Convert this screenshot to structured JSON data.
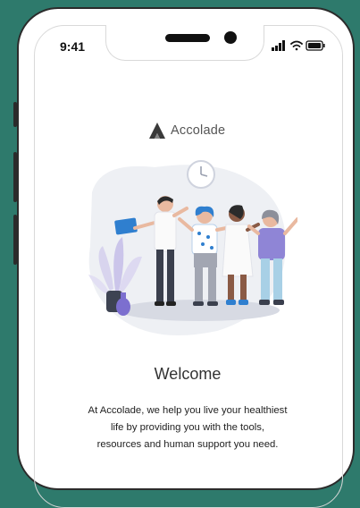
{
  "status_bar": {
    "time": "9:41",
    "icons": [
      "signal-icon",
      "wifi-icon",
      "battery-icon"
    ]
  },
  "brand": {
    "name": "Accolade",
    "logo_icon": "accolade-logo-icon"
  },
  "welcome": {
    "title": "Welcome",
    "description_lines": [
      "At Accolade, we help you live your healthiest",
      "life by providing you with the tools,",
      "resources and human support you need."
    ]
  },
  "colors": {
    "background": "#2e7a6c",
    "phone_frame": "#2b2b2b",
    "accent_blue": "#2f7fcf",
    "accent_purple": "#7c6fcf"
  }
}
